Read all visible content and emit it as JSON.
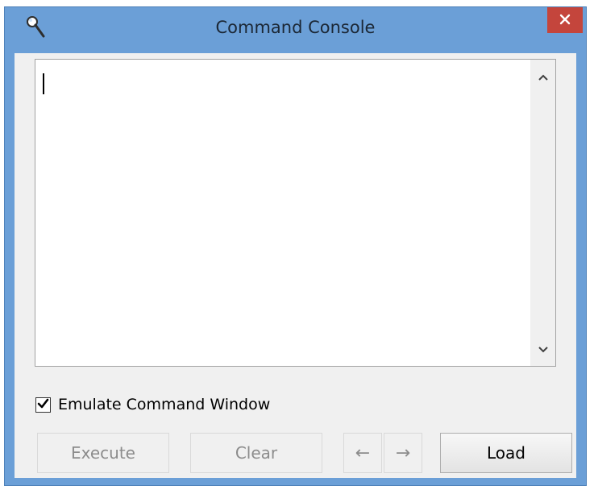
{
  "window": {
    "title": "Command Console",
    "close_glyph": "✕"
  },
  "console": {
    "value": "",
    "scroll_up_glyph": "⌃",
    "scroll_down_glyph": "⌄"
  },
  "options": {
    "emulate_label": "Emulate Command Window",
    "emulate_checked": true,
    "check_glyph": "✔"
  },
  "buttons": {
    "execute": "Execute",
    "clear": "Clear",
    "prev": "←",
    "next": "→",
    "load": "Load"
  },
  "icons": {
    "app": "magnifier-icon",
    "close": "close-icon",
    "scroll_up": "chevron-up-icon",
    "scroll_down": "chevron-down-icon",
    "check": "checkmark-icon"
  },
  "colors": {
    "titlebar": "#6b9fd7",
    "close_button": "#c4453c",
    "panel": "#f0f0f0",
    "disabled_text": "#8c8c8c"
  }
}
